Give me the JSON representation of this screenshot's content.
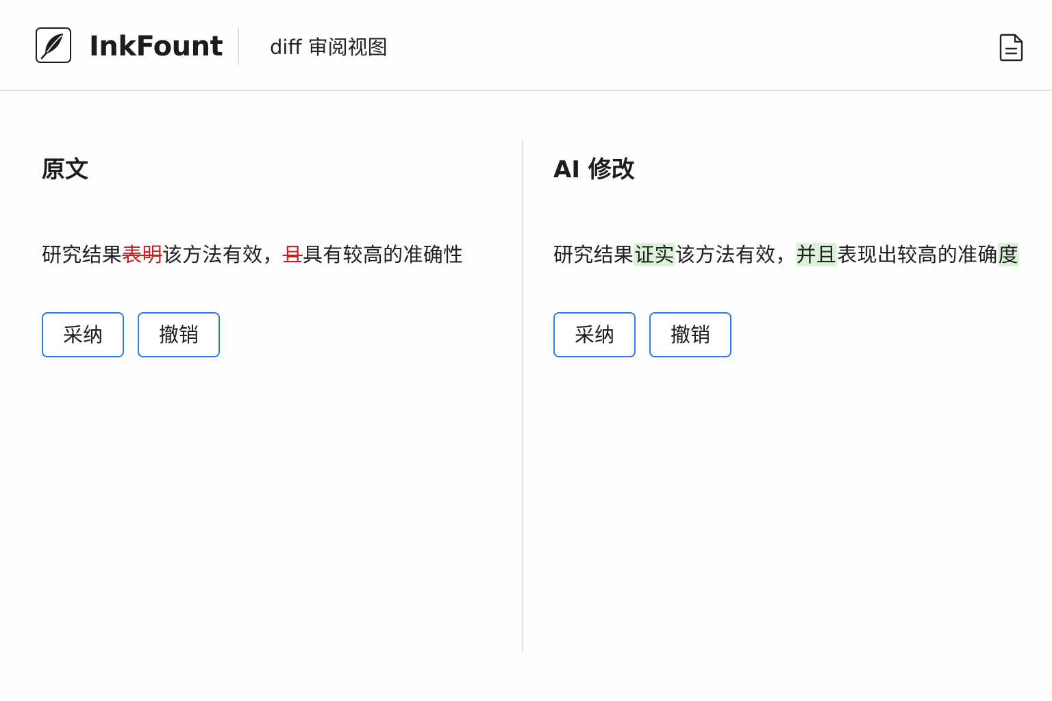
{
  "header": {
    "brand": "InkFount",
    "view_title": "diff 审阅视图",
    "logo_icon": "feather-icon",
    "doc_icon": "document-icon"
  },
  "left": {
    "title": "原文",
    "segments": [
      {
        "text": "研究结果",
        "kind": "normal"
      },
      {
        "text": "表明",
        "kind": "deleted"
      },
      {
        "text": "该方法有效，",
        "kind": "normal"
      },
      {
        "text": "且",
        "kind": "deleted"
      },
      {
        "text": "具有较高的准确性",
        "kind": "normal"
      }
    ],
    "accept_label": "采纳",
    "revert_label": "撤销"
  },
  "right": {
    "title": "AI 修改",
    "segments": [
      {
        "text": "研究结果",
        "kind": "normal"
      },
      {
        "text": "证实",
        "kind": "inserted"
      },
      {
        "text": "该方法有效，",
        "kind": "normal"
      },
      {
        "text": "并且",
        "kind": "inserted"
      },
      {
        "text": "表现出较高的准确",
        "kind": "normal"
      },
      {
        "text": "度",
        "kind": "inserted"
      }
    ],
    "accept_label": "采纳",
    "revert_label": "撤销"
  },
  "colors": {
    "accent": "#2e7ae6",
    "deleted": "#c51f1f",
    "inserted_bg": "#dcf3d9"
  }
}
